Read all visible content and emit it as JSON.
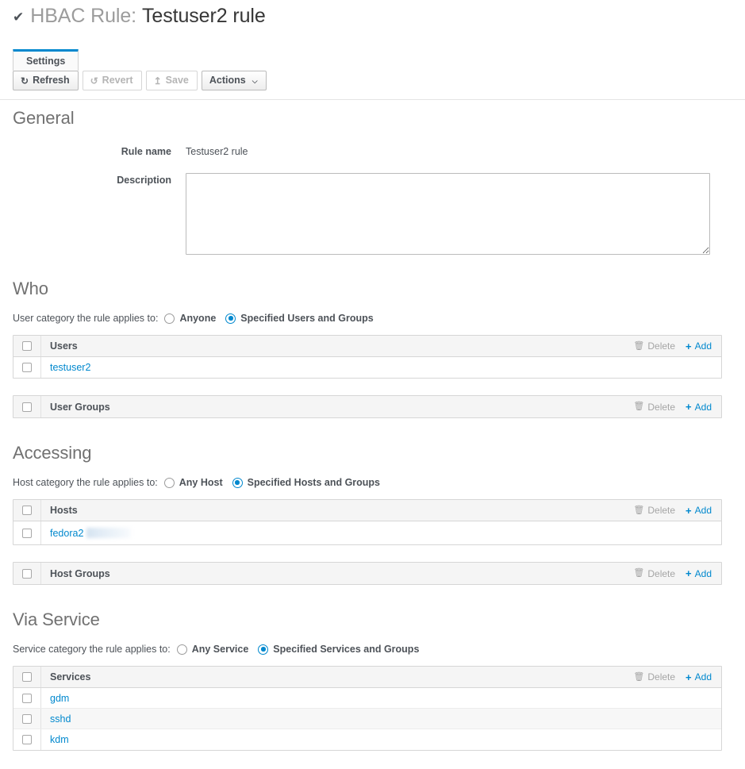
{
  "page": {
    "check_icon": "check-icon",
    "title_prefix": "HBAC Rule:",
    "title_name": "Testuser2 rule"
  },
  "tabs": [
    {
      "label": "Settings",
      "active": true
    }
  ],
  "toolbar": {
    "refresh": {
      "label": "Refresh",
      "icon": "refresh-icon",
      "glyph": "↻",
      "disabled": false
    },
    "revert": {
      "label": "Revert",
      "icon": "revert-icon",
      "glyph": "↺",
      "disabled": true
    },
    "save": {
      "label": "Save",
      "icon": "save-upload-icon",
      "glyph": "↥",
      "disabled": true
    },
    "actions": {
      "label": "Actions",
      "caret": "⌵"
    }
  },
  "general": {
    "heading": "General",
    "rule_name_label": "Rule name",
    "rule_name_value": "Testuser2 rule",
    "description_label": "Description",
    "description_value": "",
    "description_placeholder": ""
  },
  "who": {
    "heading": "Who",
    "category_prompt": "User category the rule applies to:",
    "options": [
      {
        "label": "Anyone",
        "selected": false
      },
      {
        "label": "Specified Users and Groups",
        "selected": true
      }
    ],
    "tables": [
      {
        "title": "Users",
        "delete_label": "Delete",
        "add_label": "Add",
        "rows": [
          {
            "text": "testuser2",
            "redacted": false
          }
        ]
      },
      {
        "title": "User Groups",
        "delete_label": "Delete",
        "add_label": "Add",
        "rows": []
      }
    ]
  },
  "accessing": {
    "heading": "Accessing",
    "category_prompt": "Host category the rule applies to:",
    "options": [
      {
        "label": "Any Host",
        "selected": false
      },
      {
        "label": "Specified Hosts and Groups",
        "selected": true
      }
    ],
    "tables": [
      {
        "title": "Hosts",
        "delete_label": "Delete",
        "add_label": "Add",
        "rows": [
          {
            "text": "fedora2",
            "redacted": true
          }
        ]
      },
      {
        "title": "Host Groups",
        "delete_label": "Delete",
        "add_label": "Add",
        "rows": []
      }
    ]
  },
  "via_service": {
    "heading": "Via Service",
    "category_prompt": "Service category the rule applies to:",
    "options": [
      {
        "label": "Any Service",
        "selected": false
      },
      {
        "label": "Specified Services and Groups",
        "selected": true
      }
    ],
    "tables": [
      {
        "title": "Services",
        "delete_label": "Delete",
        "add_label": "Add",
        "rows": [
          {
            "text": "gdm",
            "redacted": false
          },
          {
            "text": "sshd",
            "redacted": false
          },
          {
            "text": "kdm",
            "redacted": false
          }
        ]
      }
    ]
  },
  "colors": {
    "accent": "#0088ce",
    "link": "#0088ce",
    "heading": "#717171",
    "text": "#4d5258",
    "disabled": "#b5b5b5",
    "table_header_bg": "#f5f5f5",
    "row_alt_bg": "#f7f7f7"
  }
}
